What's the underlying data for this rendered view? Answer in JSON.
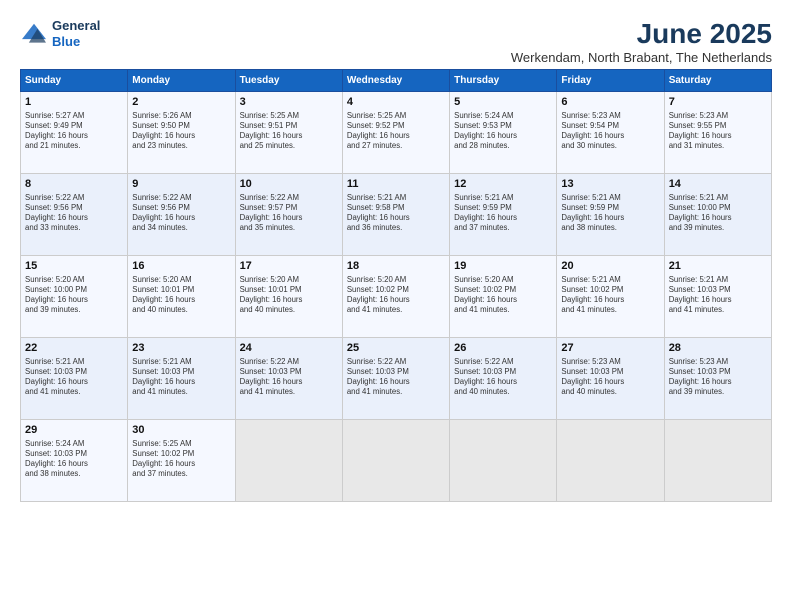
{
  "header": {
    "logo_line1": "General",
    "logo_line2": "Blue",
    "month_title": "June 2025",
    "location": "Werkendam, North Brabant, The Netherlands"
  },
  "days_of_week": [
    "Sunday",
    "Monday",
    "Tuesday",
    "Wednesday",
    "Thursday",
    "Friday",
    "Saturday"
  ],
  "weeks": [
    [
      {
        "day": "1",
        "lines": [
          "Sunrise: 5:27 AM",
          "Sunset: 9:49 PM",
          "Daylight: 16 hours",
          "and 21 minutes."
        ]
      },
      {
        "day": "2",
        "lines": [
          "Sunrise: 5:26 AM",
          "Sunset: 9:50 PM",
          "Daylight: 16 hours",
          "and 23 minutes."
        ]
      },
      {
        "day": "3",
        "lines": [
          "Sunrise: 5:25 AM",
          "Sunset: 9:51 PM",
          "Daylight: 16 hours",
          "and 25 minutes."
        ]
      },
      {
        "day": "4",
        "lines": [
          "Sunrise: 5:25 AM",
          "Sunset: 9:52 PM",
          "Daylight: 16 hours",
          "and 27 minutes."
        ]
      },
      {
        "day": "5",
        "lines": [
          "Sunrise: 5:24 AM",
          "Sunset: 9:53 PM",
          "Daylight: 16 hours",
          "and 28 minutes."
        ]
      },
      {
        "day": "6",
        "lines": [
          "Sunrise: 5:23 AM",
          "Sunset: 9:54 PM",
          "Daylight: 16 hours",
          "and 30 minutes."
        ]
      },
      {
        "day": "7",
        "lines": [
          "Sunrise: 5:23 AM",
          "Sunset: 9:55 PM",
          "Daylight: 16 hours",
          "and 31 minutes."
        ]
      }
    ],
    [
      {
        "day": "8",
        "lines": [
          "Sunrise: 5:22 AM",
          "Sunset: 9:56 PM",
          "Daylight: 16 hours",
          "and 33 minutes."
        ]
      },
      {
        "day": "9",
        "lines": [
          "Sunrise: 5:22 AM",
          "Sunset: 9:56 PM",
          "Daylight: 16 hours",
          "and 34 minutes."
        ]
      },
      {
        "day": "10",
        "lines": [
          "Sunrise: 5:22 AM",
          "Sunset: 9:57 PM",
          "Daylight: 16 hours",
          "and 35 minutes."
        ]
      },
      {
        "day": "11",
        "lines": [
          "Sunrise: 5:21 AM",
          "Sunset: 9:58 PM",
          "Daylight: 16 hours",
          "and 36 minutes."
        ]
      },
      {
        "day": "12",
        "lines": [
          "Sunrise: 5:21 AM",
          "Sunset: 9:59 PM",
          "Daylight: 16 hours",
          "and 37 minutes."
        ]
      },
      {
        "day": "13",
        "lines": [
          "Sunrise: 5:21 AM",
          "Sunset: 9:59 PM",
          "Daylight: 16 hours",
          "and 38 minutes."
        ]
      },
      {
        "day": "14",
        "lines": [
          "Sunrise: 5:21 AM",
          "Sunset: 10:00 PM",
          "Daylight: 16 hours",
          "and 39 minutes."
        ]
      }
    ],
    [
      {
        "day": "15",
        "lines": [
          "Sunrise: 5:20 AM",
          "Sunset: 10:00 PM",
          "Daylight: 16 hours",
          "and 39 minutes."
        ]
      },
      {
        "day": "16",
        "lines": [
          "Sunrise: 5:20 AM",
          "Sunset: 10:01 PM",
          "Daylight: 16 hours",
          "and 40 minutes."
        ]
      },
      {
        "day": "17",
        "lines": [
          "Sunrise: 5:20 AM",
          "Sunset: 10:01 PM",
          "Daylight: 16 hours",
          "and 40 minutes."
        ]
      },
      {
        "day": "18",
        "lines": [
          "Sunrise: 5:20 AM",
          "Sunset: 10:02 PM",
          "Daylight: 16 hours",
          "and 41 minutes."
        ]
      },
      {
        "day": "19",
        "lines": [
          "Sunrise: 5:20 AM",
          "Sunset: 10:02 PM",
          "Daylight: 16 hours",
          "and 41 minutes."
        ]
      },
      {
        "day": "20",
        "lines": [
          "Sunrise: 5:21 AM",
          "Sunset: 10:02 PM",
          "Daylight: 16 hours",
          "and 41 minutes."
        ]
      },
      {
        "day": "21",
        "lines": [
          "Sunrise: 5:21 AM",
          "Sunset: 10:03 PM",
          "Daylight: 16 hours",
          "and 41 minutes."
        ]
      }
    ],
    [
      {
        "day": "22",
        "lines": [
          "Sunrise: 5:21 AM",
          "Sunset: 10:03 PM",
          "Daylight: 16 hours",
          "and 41 minutes."
        ]
      },
      {
        "day": "23",
        "lines": [
          "Sunrise: 5:21 AM",
          "Sunset: 10:03 PM",
          "Daylight: 16 hours",
          "and 41 minutes."
        ]
      },
      {
        "day": "24",
        "lines": [
          "Sunrise: 5:22 AM",
          "Sunset: 10:03 PM",
          "Daylight: 16 hours",
          "and 41 minutes."
        ]
      },
      {
        "day": "25",
        "lines": [
          "Sunrise: 5:22 AM",
          "Sunset: 10:03 PM",
          "Daylight: 16 hours",
          "and 41 minutes."
        ]
      },
      {
        "day": "26",
        "lines": [
          "Sunrise: 5:22 AM",
          "Sunset: 10:03 PM",
          "Daylight: 16 hours",
          "and 40 minutes."
        ]
      },
      {
        "day": "27",
        "lines": [
          "Sunrise: 5:23 AM",
          "Sunset: 10:03 PM",
          "Daylight: 16 hours",
          "and 40 minutes."
        ]
      },
      {
        "day": "28",
        "lines": [
          "Sunrise: 5:23 AM",
          "Sunset: 10:03 PM",
          "Daylight: 16 hours",
          "and 39 minutes."
        ]
      }
    ],
    [
      {
        "day": "29",
        "lines": [
          "Sunrise: 5:24 AM",
          "Sunset: 10:03 PM",
          "Daylight: 16 hours",
          "and 38 minutes."
        ]
      },
      {
        "day": "30",
        "lines": [
          "Sunrise: 5:25 AM",
          "Sunset: 10:02 PM",
          "Daylight: 16 hours",
          "and 37 minutes."
        ]
      },
      {
        "day": "",
        "lines": []
      },
      {
        "day": "",
        "lines": []
      },
      {
        "day": "",
        "lines": []
      },
      {
        "day": "",
        "lines": []
      },
      {
        "day": "",
        "lines": []
      }
    ]
  ]
}
